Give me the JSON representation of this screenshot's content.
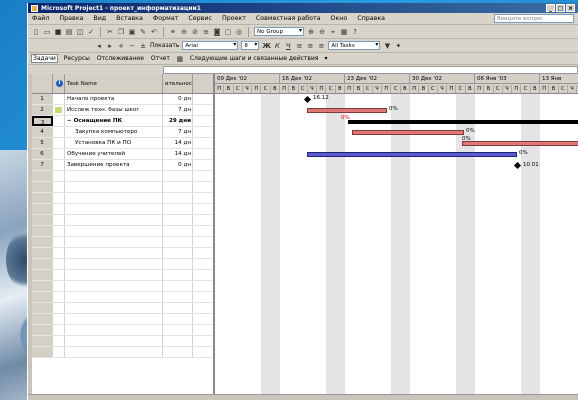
{
  "window": {
    "title": "Microsoft Project1 - проект_информатизации1"
  },
  "menu": [
    "Файл",
    "Правка",
    "Вид",
    "Вставка",
    "Формат",
    "Сервис",
    "Проект",
    "Совместная работа",
    "Окно",
    "Справка"
  ],
  "help_placeholder": "Введите вопрос",
  "toolbar": {
    "group_combo": "No Group",
    "font_combo": "Arial",
    "size_combo": "8",
    "filter_combo": "All Tasks",
    "show_label": "Показать"
  },
  "viewbar": {
    "items": [
      "Задачи",
      "Ресурсы",
      "Отслеживание",
      "Отчет"
    ],
    "next_steps": "Следующие шаги и связанные действия"
  },
  "grid": {
    "col_name": "Task Name",
    "col_dur": "ительнос"
  },
  "tasks": [
    {
      "num": "1",
      "name": "Начало проекта",
      "dur": "0 дн",
      "summary": false
    },
    {
      "num": "2",
      "name": "Исслеж техн. базы шког",
      "dur": "7 дн",
      "summary": false,
      "note": true
    },
    {
      "num": "3",
      "name": "Оснащение ПК",
      "dur": "29 дни",
      "summary": true,
      "selected": true
    },
    {
      "num": "4",
      "name": "Закупка компьютеро",
      "dur": "7 дн",
      "summary": false
    },
    {
      "num": "5",
      "name": "Установка ПК и ПО",
      "dur": "14 дн",
      "summary": false
    },
    {
      "num": "6",
      "name": "Обучение учителей",
      "dur": "14 дн",
      "summary": false
    },
    {
      "num": "7",
      "name": "Завершение проекта",
      "dur": "0 дн",
      "summary": false
    }
  ],
  "timescale": {
    "weeks": [
      "09 Дек '02",
      "16 Дек '02",
      "23 Дек '02",
      "30 Дек '02",
      "06 Янв '03",
      "13 Янв"
    ],
    "days": [
      "П",
      "В",
      "С",
      "Ч",
      "П",
      "С",
      "В"
    ]
  },
  "gantt_labels": {
    "start_ms": "16.12",
    "end_ms": "10.01",
    "pct": "0%"
  },
  "colors": {
    "bar_red": "#e07878",
    "bar_blue": "#5a5ad2",
    "summary": "#000000"
  }
}
